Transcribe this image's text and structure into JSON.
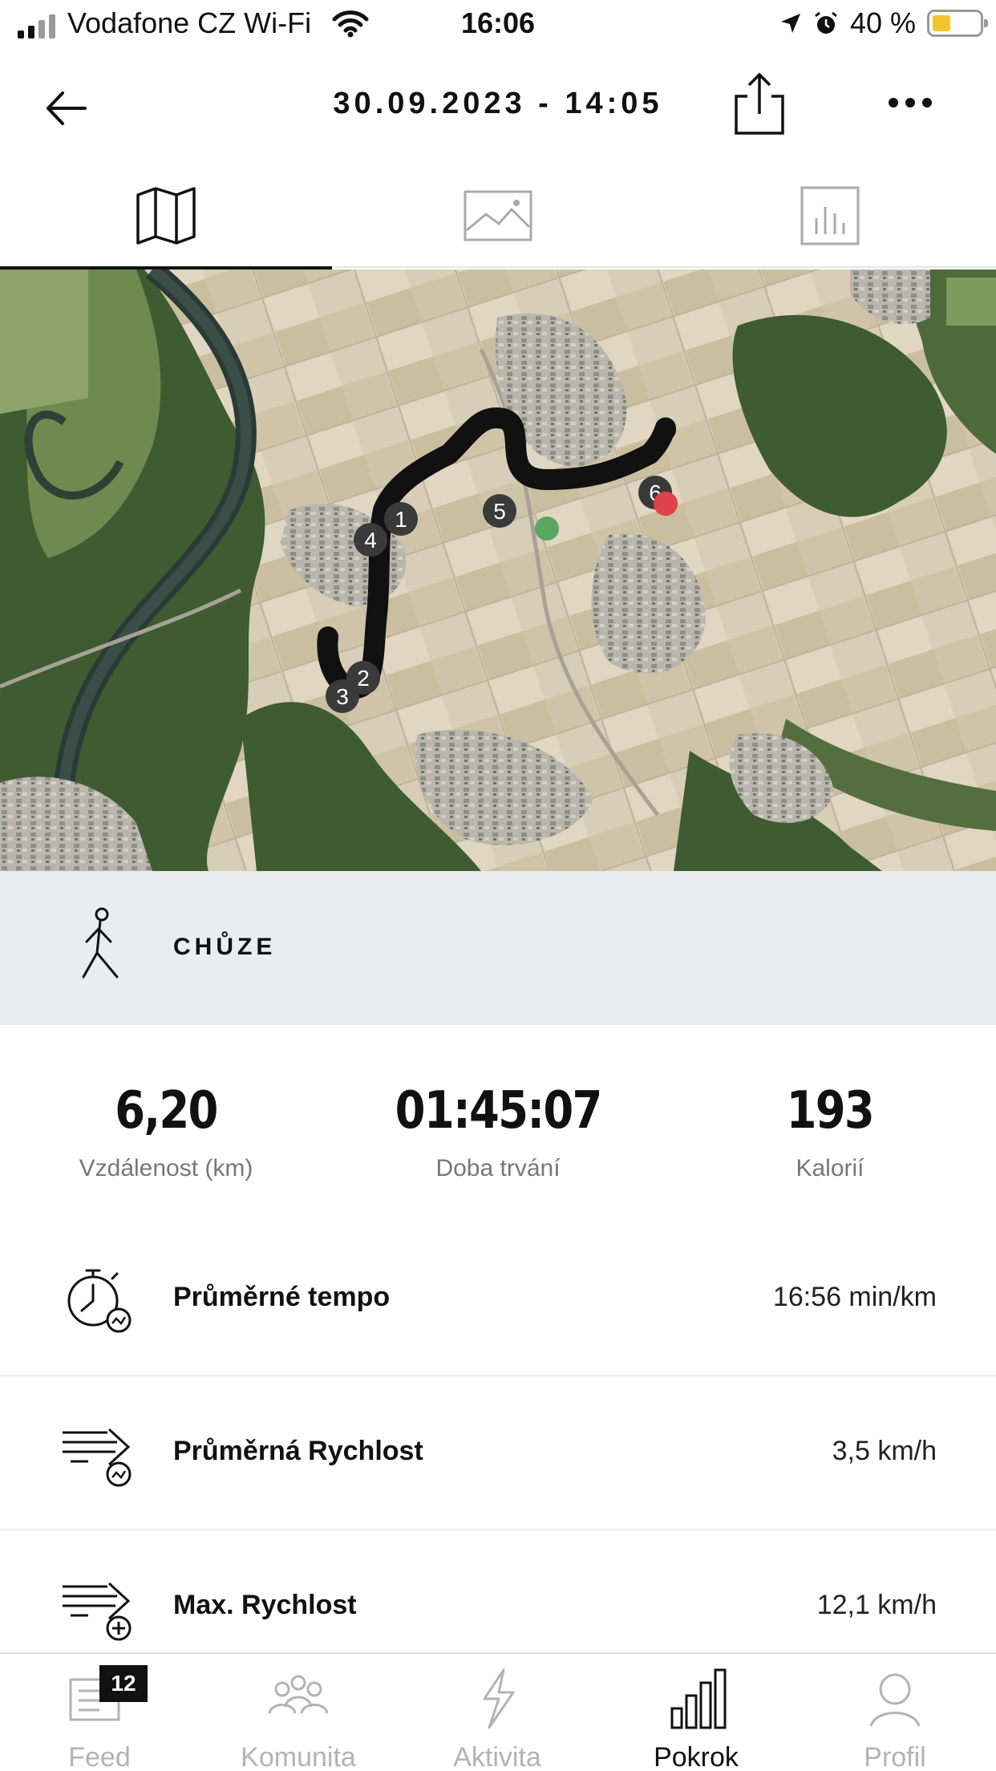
{
  "status_bar": {
    "carrier": "Vodafone CZ Wi-Fi",
    "time": "16:06",
    "battery": "40 %",
    "battery_level": 0.4
  },
  "header": {
    "title": "30.09.2023 - 14:05"
  },
  "tabs": [
    {
      "icon": "map-icon",
      "active": true
    },
    {
      "icon": "photo-icon",
      "active": false
    },
    {
      "icon": "stats-icon",
      "active": false
    }
  ],
  "map": {
    "markers": [
      "1",
      "2",
      "3",
      "4",
      "5",
      "6"
    ],
    "start_color": "#5aa860",
    "end_color": "#e0424b"
  },
  "activity": {
    "icon": "walking-person-icon",
    "label": "CHŮZE"
  },
  "summary": {
    "distance": {
      "value": "6,20",
      "label": "Vzdálenost (km)"
    },
    "duration": {
      "value": "01:45:07",
      "label": "Doba trvání"
    },
    "calories": {
      "value": "193",
      "label": "Kalorií"
    }
  },
  "metrics": [
    {
      "icon": "stopwatch-pace-icon",
      "label": "Průměrné tempo",
      "value": "16:56 min/km"
    },
    {
      "icon": "speed-average-icon",
      "label": "Průměrná Rychlost",
      "value": "3,5 km/h"
    },
    {
      "icon": "speed-max-icon",
      "label": "Max. Rychlost",
      "value": "12,1 km/h"
    }
  ],
  "nav": {
    "items": [
      {
        "label": "Feed",
        "icon": "feed-icon",
        "badge": "12"
      },
      {
        "label": "Komunita",
        "icon": "community-icon"
      },
      {
        "label": "Aktivita",
        "icon": "lightning-icon"
      },
      {
        "label": "Pokrok",
        "icon": "progress-bars-icon",
        "active": true
      },
      {
        "label": "Profil",
        "icon": "profile-icon"
      }
    ]
  }
}
